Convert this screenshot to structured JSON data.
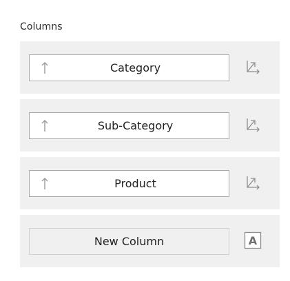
{
  "section": {
    "title": "Columns"
  },
  "columns": [
    {
      "label": "Category",
      "sort_icon": "sort-ascending-icon",
      "action_icon": "sort-options-icon"
    },
    {
      "label": "Sub-Category",
      "sort_icon": "sort-ascending-icon",
      "action_icon": "sort-options-icon"
    },
    {
      "label": "Product",
      "sort_icon": "sort-ascending-icon",
      "action_icon": "sort-options-icon"
    }
  ],
  "new_column": {
    "label": "New Column",
    "icon": "text-type-icon",
    "icon_glyph": "A"
  },
  "colors": {
    "row_bg": "#f0f0f0",
    "field_border": "#a9a9a9",
    "icon_gray": "#8c8c8c"
  }
}
